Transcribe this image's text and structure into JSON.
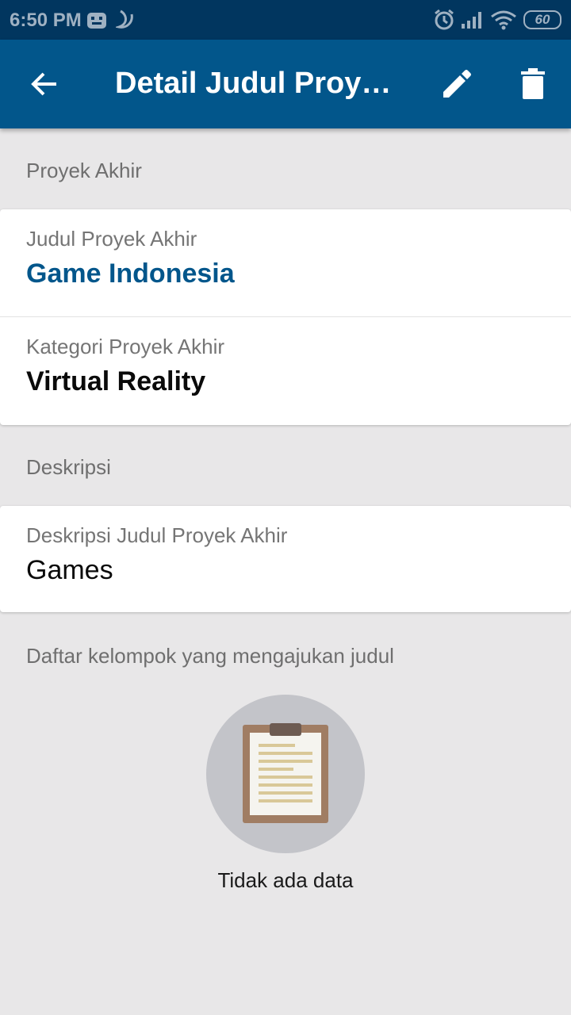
{
  "status_bar": {
    "time": "6:50 PM",
    "battery": "60"
  },
  "app_bar": {
    "title": "Detail Judul Proyek Akhir"
  },
  "sections": {
    "proyek_akhir": "Proyek Akhir",
    "deskripsi": "Deskripsi",
    "daftar_kelompok": "Daftar kelompok yang mengajukan judul"
  },
  "fields": {
    "judul": {
      "label": "Judul Proyek Akhir",
      "value": "Game Indonesia"
    },
    "kategori": {
      "label": "Kategori Proyek Akhir",
      "value": "Virtual Reality"
    },
    "deskripsi": {
      "label": "Deskripsi Judul Proyek Akhir",
      "value": "Games"
    }
  },
  "empty_state": {
    "text": "Tidak ada data"
  },
  "colors": {
    "primary": "#02568b",
    "status_bar": "#01365f",
    "accent_text": "#02568b",
    "background": "#e8e7e8"
  },
  "icons": [
    "back-arrow-icon",
    "edit-pencil-icon",
    "delete-trash-icon",
    "clipboard-icon"
  ]
}
